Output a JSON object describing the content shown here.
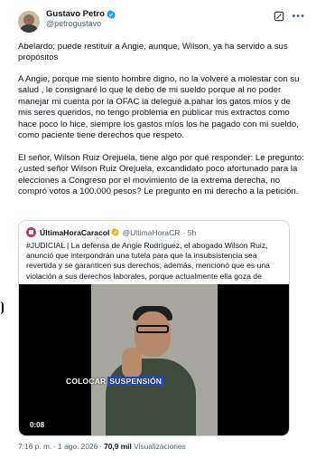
{
  "header": {
    "display_name": "Gustavo Petro",
    "handle": "@petrogustavo",
    "grok_icon": "grok-icon",
    "more_icon": "more-icon"
  },
  "tweet": {
    "paragraph_1": "Abelardo; puede restituir a Angie, aunque, Wilson, ya ha servido a sus propósitos",
    "paragraph_2": "A Angie, porque me siento hombre digno, no la volveré a molestar con su salud , le  consignaré lo que le debo de mi sueldo porque al no poder manejar mi cuenta por la OFAC la delegué a.pahar los gatos míos y de mis seres queridos, no tengo problema en publicar mis extractos como hace poco lo hice, siempre los gastos míos los he pagado con mi sueldo, como paciente tiene derechos que respeto.",
    "paragraph_3": "El señor, Wilson Ruiz Orejuela,  tiene algo por qué responder: Le pregunto:  ¿usted señor Wilson Ruiz Orejuela, excandidato poco afortunado para la elecciones a Congreso por el movimiento de la extrema derecha, no compró votos a 100.000 pesos? Le pregunto en mi derecho a la petición."
  },
  "quote": {
    "name": "ÚltimaHoraCaracol",
    "handle": "@UltimaHoraCR",
    "time": "· 5h",
    "text": "#JUDICIAL | La defensa de Angie Rodríguez, el abogado Wilson Ruiz, anunció que interpondrán una tutela para que la insubsistencia sea revertida y se garanticen sus derechos; además, mencionó que es una violación a sus derechos laborales, porque actualmente ella goza de",
    "video": {
      "caption_plain": "COLOCAR",
      "caption_highlight": "SUSPENSIÓN",
      "timer": "0:08"
    }
  },
  "footer": {
    "time": "7:16 p. m.",
    "date": "1 ago. 2026",
    "views_count": "70,9 mil",
    "views_label": "Visualizaciones"
  },
  "colors": {
    "text": "#0f1419",
    "muted": "#536471",
    "verified": "#1d9bf0",
    "border": "#cfd9de",
    "caption_highlight": "#1d4ed8"
  }
}
